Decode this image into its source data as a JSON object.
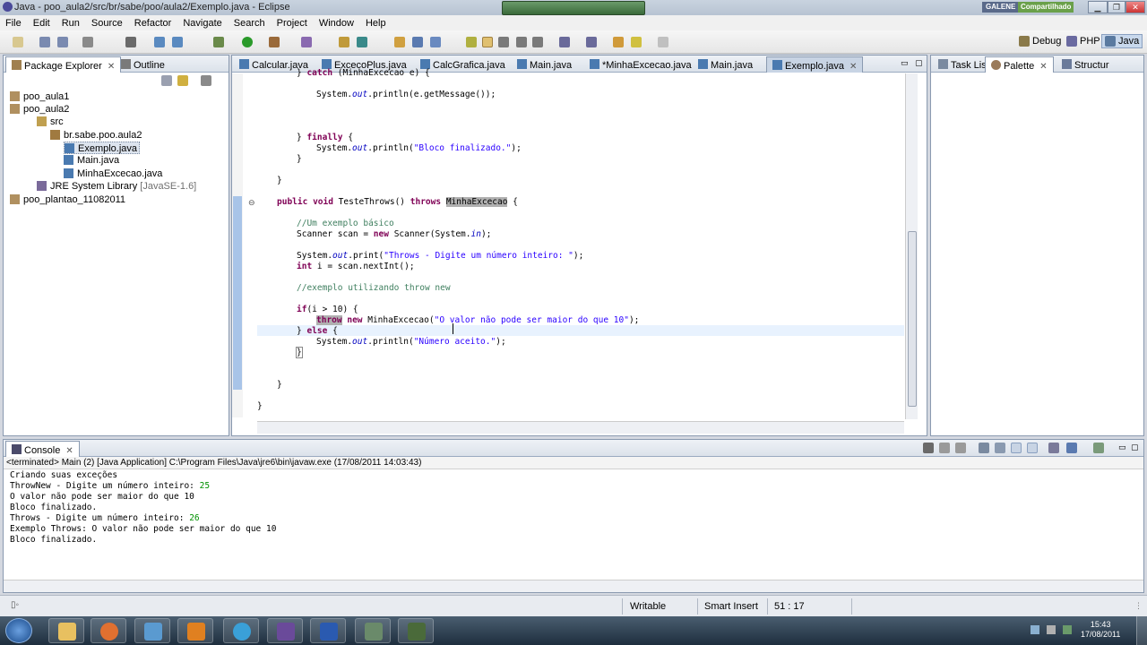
{
  "window": {
    "title": "Java - poo_aula2/src/br/sabe/poo/aula2/Exemplo.java - Eclipse",
    "badge_left": "GALENE",
    "badge_right": "Compartilhado"
  },
  "menu": [
    "File",
    "Edit",
    "Run",
    "Source",
    "Refactor",
    "Navigate",
    "Search",
    "Project",
    "Window",
    "Help"
  ],
  "perspectives": {
    "debug": "Debug",
    "php": "PHP",
    "java": "Java"
  },
  "left_panel": {
    "tabs": [
      "Package Explorer",
      "Outline"
    ],
    "tree": [
      {
        "label": "poo_aula1",
        "icon": "project-icon"
      },
      {
        "label": "poo_aula2",
        "icon": "project-icon"
      },
      {
        "label": "src",
        "icon": "source-folder-icon"
      },
      {
        "label": "br.sabe.poo.aula2",
        "icon": "package-icon"
      },
      {
        "label": "Exemplo.java",
        "icon": "java-file-icon"
      },
      {
        "label": "Main.java",
        "icon": "java-file-icon"
      },
      {
        "label": "MinhaExcecao.java",
        "icon": "java-file-icon"
      },
      {
        "label": "JRE System Library",
        "extra": "[JavaSE-1.6]",
        "icon": "library-icon"
      },
      {
        "label": "poo_plantao_11082011",
        "icon": "project-icon"
      }
    ]
  },
  "editor": {
    "tabs": [
      "Calcular.java",
      "ExcecoPlus.java",
      "CalcGrafica.java",
      "Main.java",
      "*MinhaExcecao.java",
      "Main.java",
      "Exemplo.java"
    ],
    "active_tab_index": 6
  },
  "right_panel": {
    "tabs": [
      "Task List",
      "Palette",
      "Structur"
    ]
  },
  "console": {
    "tab": "Console",
    "header": "<terminated> Main (2) [Java Application] C:\\Program Files\\Java\\jre6\\bin\\javaw.exe (17/08/2011 14:03:43)",
    "lines": [
      {
        "text": "Criando suas exceções",
        "input": ""
      },
      {
        "text": "ThrowNew - Digite um número inteiro: ",
        "input": "25"
      },
      {
        "text": "O valor não pode ser maior do que 10",
        "input": ""
      },
      {
        "text": "Bloco finalizado.",
        "input": ""
      },
      {
        "text": "Throws - Digite um número inteiro: ",
        "input": "26"
      },
      {
        "text": "Exemplo Throws: O valor não pode ser maior do que 10",
        "input": ""
      },
      {
        "text": "Bloco finalizado.",
        "input": ""
      }
    ]
  },
  "status": {
    "writable": "Writable",
    "insert_mode": "Smart Insert",
    "position": "51 : 17"
  },
  "clock": {
    "time": "15:43",
    "date": "17/08/2011"
  }
}
